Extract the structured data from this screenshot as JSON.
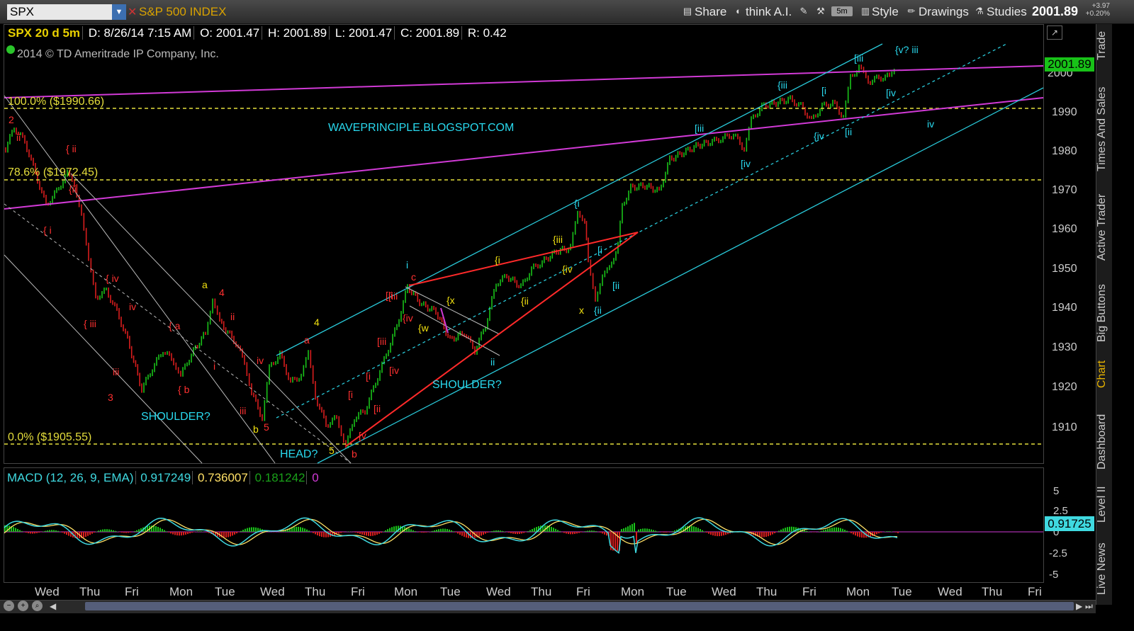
{
  "toolbar": {
    "symbol": "SPX",
    "symbol_name": "S&P 500 INDEX",
    "share": "Share",
    "think_ai": "think A.I.",
    "timeframe": "5m",
    "style": "Style",
    "drawings": "Drawings",
    "studies": "Studies",
    "last_price": "2001.89",
    "change": "+3.97",
    "change_pct": "+0.20%"
  },
  "info_bar": {
    "symbol_period": "SPX 20 d 5m",
    "date": "D: 8/26/14 7:15 AM",
    "open": "O: 2001.47",
    "high": "H: 2001.89",
    "low": "L: 2001.47",
    "close": "C: 2001.89",
    "range": "R: 0.42"
  },
  "copyright": "2014 © TD Ameritrade IP Company, Inc.",
  "watermark_text": "WAVEPRINCIPLE.BLOGSPOT.COM",
  "price_axis": [
    "2000",
    "1990",
    "1980",
    "1970",
    "1960",
    "1950",
    "1940",
    "1930",
    "1920",
    "1910"
  ],
  "price_tag": "2001.89",
  "macd": {
    "label": "MACD (12, 26, 9, EMA)",
    "value": "0.917249",
    "avg": "0.736007",
    "diff": "0.181242",
    "zero": "0",
    "axis": [
      "5",
      "2.5",
      "0",
      "-2.5",
      "-5"
    ],
    "tag": "0.91725"
  },
  "time_axis": [
    "Wed",
    "Thu",
    "Fri",
    "Mon",
    "Tue",
    "Wed",
    "Thu",
    "Fri",
    "Mon",
    "Tue",
    "Wed",
    "Thu",
    "Fri",
    "Mon",
    "Tue",
    "Wed",
    "Thu",
    "Fri",
    "Mon",
    "Tue",
    "Wed",
    "Thu",
    "Fri"
  ],
  "side_tabs": [
    "Trade",
    "Times And Sales",
    "Active Trader",
    "Big Buttons",
    "Chart",
    "Dashboard",
    "Level II",
    "Live News"
  ],
  "fib_levels": {
    "top": "100.0%  ($1990.66)",
    "mid": "78.6%  ($1972.45)",
    "bottom": "0.0%  ($1905.55)"
  },
  "pattern_labels": {
    "shoulder_left": "SHOULDER?",
    "head": "HEAD?",
    "shoulder_right": "SHOULDER?"
  },
  "wave_labels": {
    "red": [
      "2",
      "ii",
      "{ ii",
      "{ i",
      "{ iv",
      "{ iii",
      "iv",
      "iii",
      "3",
      "{ a",
      "{ b",
      "4",
      "ii",
      "i",
      "iii",
      "5",
      "iv",
      "a",
      "b",
      "c",
      "[ii",
      "{iv",
      "[iii",
      "[i",
      "[ii",
      "[v",
      "[iv",
      "[i",
      "{ii",
      "[iii"
    ],
    "yellow": [
      "a",
      "b",
      "4",
      "5",
      "{x",
      "{w",
      "{i",
      "{ii",
      "{iii",
      "{iv",
      "x"
    ],
    "cyan": [
      "i",
      "ii",
      "{i",
      "[i",
      "{ii",
      "[ii",
      "[iii",
      "[iv",
      "{iii",
      "[i",
      "{iv",
      "[ii",
      "[iii",
      "{v? iii",
      "[iv",
      "iv"
    ],
    "white": [
      "i"
    ]
  },
  "colors": {
    "up_candle": "#19c219",
    "down_candle": "#d81d1d",
    "channel": "#29c9d9",
    "trendline_magenta": "#d13ad6",
    "fib_yellow": "#e6df3c",
    "triangle_red": "#ff2a2a",
    "macd_line": "#3fd9e0",
    "macd_signal": "#ffe066",
    "macd_hist_pos": "#19c219",
    "macd_hist_neg": "#d81d1d"
  }
}
